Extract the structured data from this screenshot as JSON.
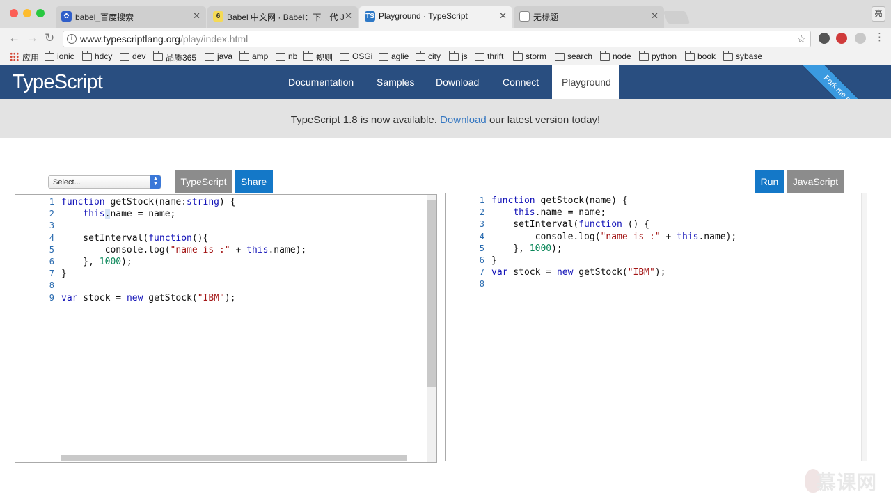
{
  "browser": {
    "tabs": [
      {
        "title": "babel_百度搜索",
        "fav_icon": "baidu-paw-icon",
        "fav_color": "#2f5ec9"
      },
      {
        "title": "Babel 中文网 · Babel：下一代 J",
        "fav_icon": "babel-6-icon",
        "fav_color": "#f5da55"
      },
      {
        "title": "Playground · TypeScript",
        "fav_icon": "ts-icon",
        "fav_color": "#2e79c7"
      },
      {
        "title": "无标题",
        "fav_icon": "page-icon",
        "fav_color": "#ffffff"
      }
    ],
    "profile_label": "亮",
    "url_host": "www.typescriptlang.org",
    "url_path": "/play/index.html",
    "bookmarks": [
      "应用",
      "ionic",
      "hdcy",
      "dev",
      "品质365",
      "java",
      "amp",
      "nb",
      "规则",
      "OSGi",
      "aglie",
      "city",
      "js",
      "thrift",
      "storm",
      "search",
      "node",
      "python",
      "book",
      "sybase"
    ]
  },
  "site": {
    "logo": "TypeScript",
    "nav": [
      "Documentation",
      "Samples",
      "Download",
      "Connect",
      "Playground"
    ],
    "ribbon": "Fork me on GitHub",
    "announce_before": "TypeScript 1.8 is now available.",
    "announce_link": "Download",
    "announce_after": "our latest version today!"
  },
  "playground": {
    "select_placeholder": "Select...",
    "left_buttons": [
      "TypeScript",
      "Share"
    ],
    "right_buttons": [
      "Run",
      "JavaScript"
    ],
    "ts_lines": [
      "function getStock(name:string) {",
      "    this.name = name;",
      "",
      "    setInterval(function(){",
      "        console.log(\"name is :\" + this.name);",
      "    }, 1000);",
      "}",
      "",
      "var stock = new getStock(\"IBM\");"
    ],
    "js_lines": [
      "function getStock(name) {",
      "    this.name = name;",
      "    setInterval(function () {",
      "        console.log(\"name is :\" + this.name);",
      "    }, 1000);",
      "}",
      "var stock = new getStock(\"IBM\");",
      ""
    ]
  },
  "watermark": "慕课网",
  "colors": {
    "nav_bg": "#294e80",
    "link": "#3577c1",
    "btn_blue": "#1478c8",
    "btn_gray": "#8c8c8c"
  }
}
